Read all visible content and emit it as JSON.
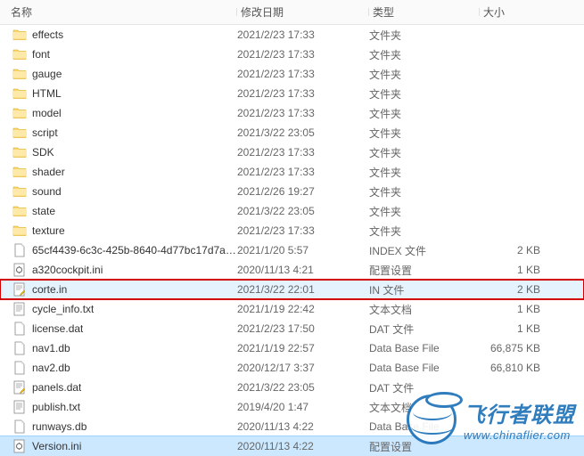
{
  "columns": {
    "name": "名称",
    "date": "修改日期",
    "type": "类型",
    "size": "大小"
  },
  "rows": [
    {
      "icon": "folder",
      "name": "effects",
      "date": "2021/2/23 17:33",
      "type": "文件夹",
      "size": "",
      "state": ""
    },
    {
      "icon": "folder",
      "name": "font",
      "date": "2021/2/23 17:33",
      "type": "文件夹",
      "size": "",
      "state": ""
    },
    {
      "icon": "folder",
      "name": "gauge",
      "date": "2021/2/23 17:33",
      "type": "文件夹",
      "size": "",
      "state": ""
    },
    {
      "icon": "folder",
      "name": "HTML",
      "date": "2021/2/23 17:33",
      "type": "文件夹",
      "size": "",
      "state": ""
    },
    {
      "icon": "folder",
      "name": "model",
      "date": "2021/2/23 17:33",
      "type": "文件夹",
      "size": "",
      "state": ""
    },
    {
      "icon": "folder",
      "name": "script",
      "date": "2021/3/22 23:05",
      "type": "文件夹",
      "size": "",
      "state": ""
    },
    {
      "icon": "folder",
      "name": "SDK",
      "date": "2021/2/23 17:33",
      "type": "文件夹",
      "size": "",
      "state": ""
    },
    {
      "icon": "folder",
      "name": "shader",
      "date": "2021/2/23 17:33",
      "type": "文件夹",
      "size": "",
      "state": ""
    },
    {
      "icon": "folder",
      "name": "sound",
      "date": "2021/2/26 19:27",
      "type": "文件夹",
      "size": "",
      "state": ""
    },
    {
      "icon": "folder",
      "name": "state",
      "date": "2021/3/22 23:05",
      "type": "文件夹",
      "size": "",
      "state": ""
    },
    {
      "icon": "folder",
      "name": "texture",
      "date": "2021/2/23 17:33",
      "type": "文件夹",
      "size": "",
      "state": ""
    },
    {
      "icon": "file",
      "name": "65cf4439-6c3c-425b-8640-4d77bc17d7aa...",
      "date": "2021/1/20 5:57",
      "type": "INDEX 文件",
      "size": "2 KB",
      "state": ""
    },
    {
      "icon": "ini",
      "name": "a320cockpit.ini",
      "date": "2020/11/13 4:21",
      "type": "配置设置",
      "size": "1 KB",
      "state": ""
    },
    {
      "icon": "edit",
      "name": "corte.in",
      "date": "2021/3/22 22:01",
      "type": "IN 文件",
      "size": "2 KB",
      "state": "highlighted"
    },
    {
      "icon": "text",
      "name": "cycle_info.txt",
      "date": "2021/1/19 22:42",
      "type": "文本文档",
      "size": "1 KB",
      "state": ""
    },
    {
      "icon": "file",
      "name": "license.dat",
      "date": "2021/2/23 17:50",
      "type": "DAT 文件",
      "size": "1 KB",
      "state": ""
    },
    {
      "icon": "file",
      "name": "nav1.db",
      "date": "2021/1/19 22:57",
      "type": "Data Base File",
      "size": "66,875 KB",
      "state": ""
    },
    {
      "icon": "file",
      "name": "nav2.db",
      "date": "2020/12/17 3:37",
      "type": "Data Base File",
      "size": "66,810 KB",
      "state": ""
    },
    {
      "icon": "edit",
      "name": "panels.dat",
      "date": "2021/3/22 23:05",
      "type": "DAT 文件",
      "size": "",
      "state": ""
    },
    {
      "icon": "text",
      "name": "publish.txt",
      "date": "2019/4/20 1:47",
      "type": "文本文档",
      "size": "",
      "state": ""
    },
    {
      "icon": "file",
      "name": "runways.db",
      "date": "2020/11/13 4:22",
      "type": "Data Base File",
      "size": "",
      "state": ""
    },
    {
      "icon": "ini",
      "name": "Version.ini",
      "date": "2020/11/13 4:22",
      "type": "配置设置",
      "size": "",
      "state": "selected"
    }
  ],
  "watermark": {
    "title": "飞行者联盟",
    "url": "www.chinaflier.com"
  }
}
